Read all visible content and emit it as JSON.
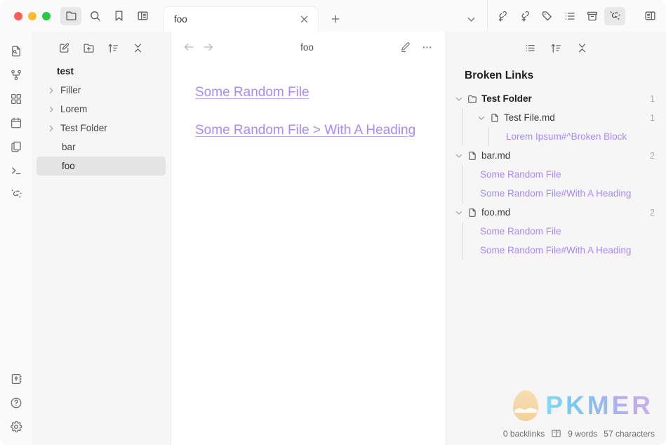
{
  "window": {
    "traffic_lights": [
      {
        "name": "close",
        "color": "#ff5f57"
      },
      {
        "name": "minimize",
        "color": "#febc2e"
      },
      {
        "name": "maximize",
        "color": "#28c840"
      }
    ],
    "header_icons": [
      {
        "name": "folder-icon",
        "label": "Files",
        "active": true
      },
      {
        "name": "search-icon",
        "label": "Search",
        "active": false
      },
      {
        "name": "bookmark-icon",
        "label": "Bookmarks",
        "active": false
      },
      {
        "name": "sidebar-left-toggle-icon",
        "label": "Toggle left sidebar",
        "active": false
      }
    ],
    "right_header_icons": [
      {
        "name": "backlinks-icon",
        "label": "Backlinks",
        "active": false
      },
      {
        "name": "outgoing-links-icon",
        "label": "Outgoing links",
        "active": false
      },
      {
        "name": "tags-icon",
        "label": "Tags",
        "active": false
      },
      {
        "name": "outline-icon",
        "label": "Outline",
        "active": false
      },
      {
        "name": "archive-icon",
        "label": "Archive",
        "active": false
      },
      {
        "name": "broken-links-icon",
        "label": "Broken Links",
        "active": true
      },
      {
        "name": "sidebar-right-toggle-icon",
        "label": "Toggle right sidebar",
        "active": false
      }
    ]
  },
  "tabs": {
    "items": [
      {
        "label": "foo",
        "active": true
      }
    ],
    "new_tab_label": "+",
    "close_label": "×",
    "dropdown_label": "⌄"
  },
  "ribbon": {
    "top_items": [
      {
        "name": "quick-switcher-icon",
        "label": "Quick switcher"
      },
      {
        "name": "graph-view-icon",
        "label": "Graph view"
      },
      {
        "name": "canvas-icon",
        "label": "Canvas"
      },
      {
        "name": "daily-note-icon",
        "label": "Daily note"
      },
      {
        "name": "templates-icon",
        "label": "Templates"
      },
      {
        "name": "terminal-icon",
        "label": "Terminal"
      },
      {
        "name": "broken-links-icon",
        "label": "Broken links"
      }
    ],
    "bottom_items": [
      {
        "name": "vault-switcher-icon",
        "label": "Open another vault"
      },
      {
        "name": "help-icon",
        "label": "Help"
      },
      {
        "name": "settings-icon",
        "label": "Settings"
      }
    ]
  },
  "explorer": {
    "toolbar": [
      {
        "name": "new-note-icon",
        "label": "New note"
      },
      {
        "name": "new-folder-icon",
        "label": "New folder"
      },
      {
        "name": "sort-order-icon",
        "label": "Change sort order"
      },
      {
        "name": "collapse-all-icon",
        "label": "Collapse all"
      }
    ],
    "vault_name": "test",
    "tree": [
      {
        "label": "Filler",
        "type": "folder",
        "expanded": false,
        "selected": false
      },
      {
        "label": "Lorem",
        "type": "folder",
        "expanded": false,
        "selected": false
      },
      {
        "label": "Test Folder",
        "type": "folder",
        "expanded": false,
        "selected": false
      },
      {
        "label": "bar",
        "type": "file",
        "selected": false
      },
      {
        "label": "foo",
        "type": "file",
        "selected": true
      }
    ]
  },
  "editor": {
    "nav": {
      "back_label": "Back",
      "forward_label": "Forward"
    },
    "title": "foo",
    "actions": [
      {
        "name": "edit-mode-icon",
        "label": "Edit"
      },
      {
        "name": "more-options-icon",
        "label": "More options"
      }
    ],
    "links": [
      {
        "text": "Some Random File",
        "color": "#a78bfa"
      },
      {
        "text": "Some Random File > With A Heading",
        "color": "#a78bfa"
      }
    ]
  },
  "broken_links_panel": {
    "toolbar": [
      {
        "name": "list-icon",
        "label": "Change list mode"
      },
      {
        "name": "sort-order-icon",
        "label": "Change sort order"
      },
      {
        "name": "collapse-all-icon",
        "label": "Collapse all"
      }
    ],
    "heading": "Broken Links",
    "tree": [
      {
        "label": "Test Folder",
        "type": "folder",
        "count": "1",
        "expanded": true,
        "depth": 0,
        "children": [
          {
            "label": "Test File.md",
            "type": "file",
            "count": "1",
            "expanded": true,
            "depth": 1,
            "children": [
              {
                "label": "Lorem Ipsum#^Broken Block",
                "type": "link",
                "depth": 2
              }
            ]
          }
        ]
      },
      {
        "label": "bar.md",
        "type": "file",
        "count": "2",
        "expanded": true,
        "depth": 0,
        "children": [
          {
            "label": "Some Random File",
            "type": "link",
            "depth": 1
          },
          {
            "label": "Some Random File#With A Heading",
            "type": "link",
            "depth": 1
          }
        ]
      },
      {
        "label": "foo.md",
        "type": "file",
        "count": "2",
        "expanded": true,
        "depth": 0,
        "children": [
          {
            "label": "Some Random File",
            "type": "link",
            "depth": 1
          },
          {
            "label": "Some Random File#With A Heading",
            "type": "link",
            "depth": 1
          }
        ]
      }
    ]
  },
  "watermark": {
    "text": "PKMER",
    "logo_name": "pkmer-egg-logo"
  },
  "statusbar": {
    "backlinks": "0 backlinks",
    "reading_icon": "book-icon",
    "words": "9 words",
    "characters": "57 characters"
  },
  "colors": {
    "link": "#a78bfa",
    "accent_active_bg": "#e8e8e8",
    "panel_bg": "#f6f6f6",
    "editor_bg": "#ffffff"
  }
}
